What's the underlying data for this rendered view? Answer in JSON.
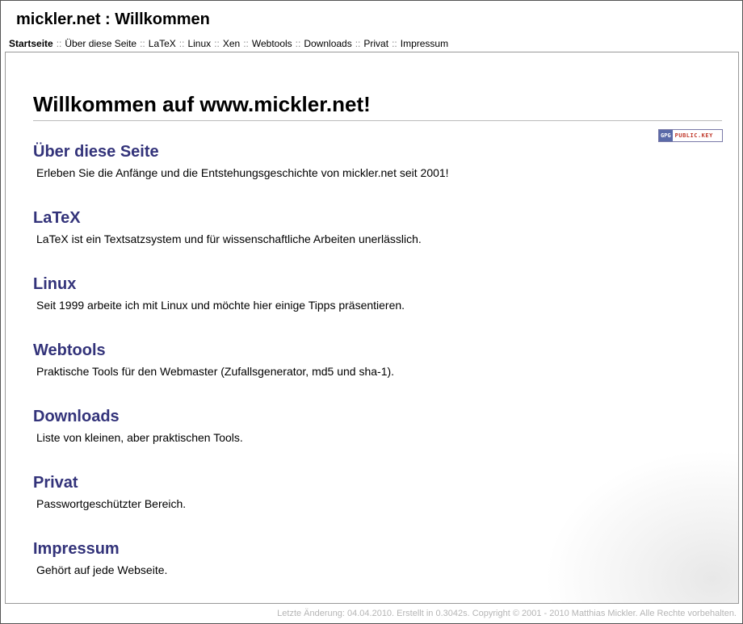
{
  "site": {
    "title": "mickler.net : Willkommen"
  },
  "nav": {
    "separator": "::",
    "items": [
      {
        "label": "Startseite",
        "active": true
      },
      {
        "label": "Über diese Seite"
      },
      {
        "label": "LaTeX"
      },
      {
        "label": "Linux"
      },
      {
        "label": "Xen"
      },
      {
        "label": "Webtools"
      },
      {
        "label": "Downloads"
      },
      {
        "label": "Privat"
      },
      {
        "label": "Impressum"
      }
    ]
  },
  "main": {
    "heading": "Willkommen auf www.mickler.net!",
    "gpg_badge": {
      "left": "GPG",
      "right": "PUBLIC.KEY"
    },
    "sections": [
      {
        "title": "Über diese Seite",
        "text": "Erleben Sie die Anfänge und die Entstehungsgeschichte von mickler.net seit 2001!"
      },
      {
        "title": "LaTeX",
        "text": "LaTeX ist ein Textsatzsystem und für wissenschaftliche Arbeiten unerlässlich."
      },
      {
        "title": "Linux",
        "text": "Seit 1999 arbeite ich mit Linux und möchte hier einige Tipps präsentieren."
      },
      {
        "title": "Webtools",
        "text": "Praktische Tools für den Webmaster (Zufallsgenerator, md5 und sha-1)."
      },
      {
        "title": "Downloads",
        "text": "Liste von kleinen, aber praktischen Tools."
      },
      {
        "title": "Privat",
        "text": "Passwortgeschützter Bereich."
      },
      {
        "title": "Impressum",
        "text": "Gehört auf jede Webseite."
      }
    ]
  },
  "footer": {
    "text": "Letzte Änderung: 04.04.2010. Erstellt in 0.3042s. Copyright © 2001 - 2010 Matthias Mickler. Alle Rechte vorbehalten."
  },
  "colors": {
    "link": "#33337a",
    "footer": "#b5b5b5",
    "border": "#999999"
  }
}
